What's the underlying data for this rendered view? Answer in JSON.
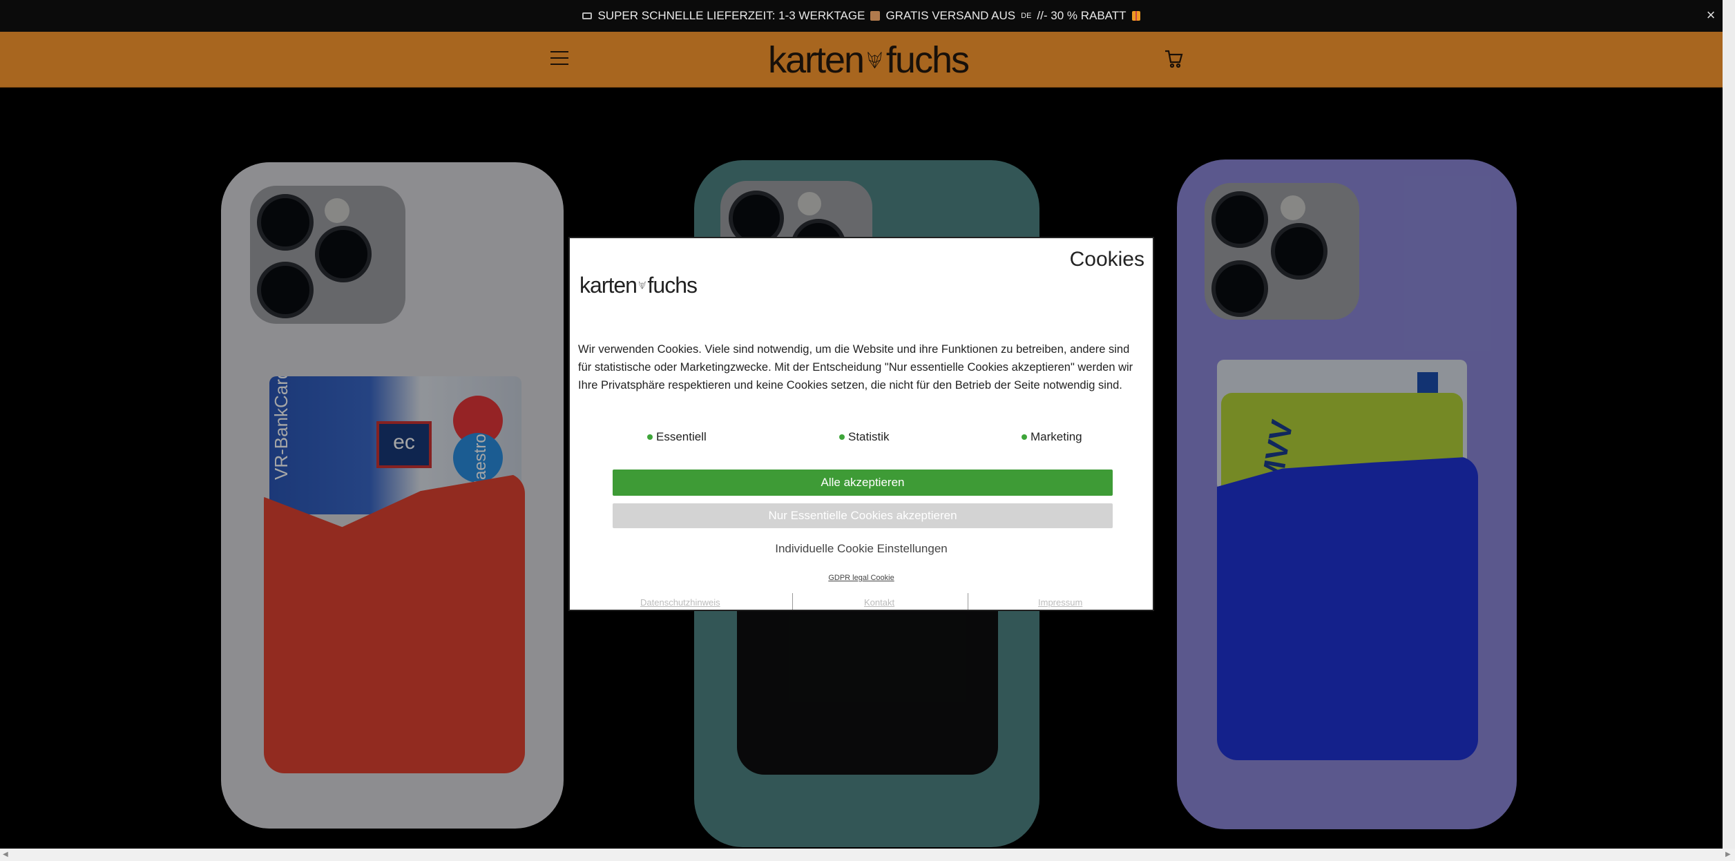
{
  "announcement": {
    "text_part1": "SUPER SCHNELLE LIEFERZEIT: 1-3 WERKTAGE",
    "text_part2": "GRATIS VERSAND AUS",
    "flag_code": "DE",
    "text_part3": "//- 30 % RABATT",
    "close_symbol": "×"
  },
  "header": {
    "logo_left": "karten",
    "logo_right": "fuchs",
    "background_color": "#a8661f"
  },
  "modal": {
    "title": "Cookies",
    "logo_left": "karten",
    "logo_right": "fuchs",
    "text": "Wir verwenden Cookies. Viele sind notwendig, um die Website und ihre Funktionen zu betreiben, andere sind für statistische oder Marketingzwecke. Mit der Entscheidung \"Nur essentielle Cookies akzeptieren\" werden wir Ihre Privatsphäre respektieren und keine Cookies setzen, die nicht für den Betrieb der Seite notwendig sind.",
    "categories": [
      "Essentiell",
      "Statistik",
      "Marketing"
    ],
    "accept_all": "Alle akzeptieren",
    "accept_essential": "Nur Essentielle Cookies akzeptieren",
    "individual": "Individuelle Cookie Einstellungen",
    "gdpr": "GDPR legal Cookie",
    "footer_links": [
      "Datenschutzhinweis",
      "Kontakt",
      "Impressum"
    ],
    "accent_color": "#3e9b36"
  },
  "hero": {
    "card_left_text": "VR-BankCard",
    "card_left_brand": "Maestro",
    "card_left_logo": "ec",
    "card_right_text": "MVV"
  }
}
